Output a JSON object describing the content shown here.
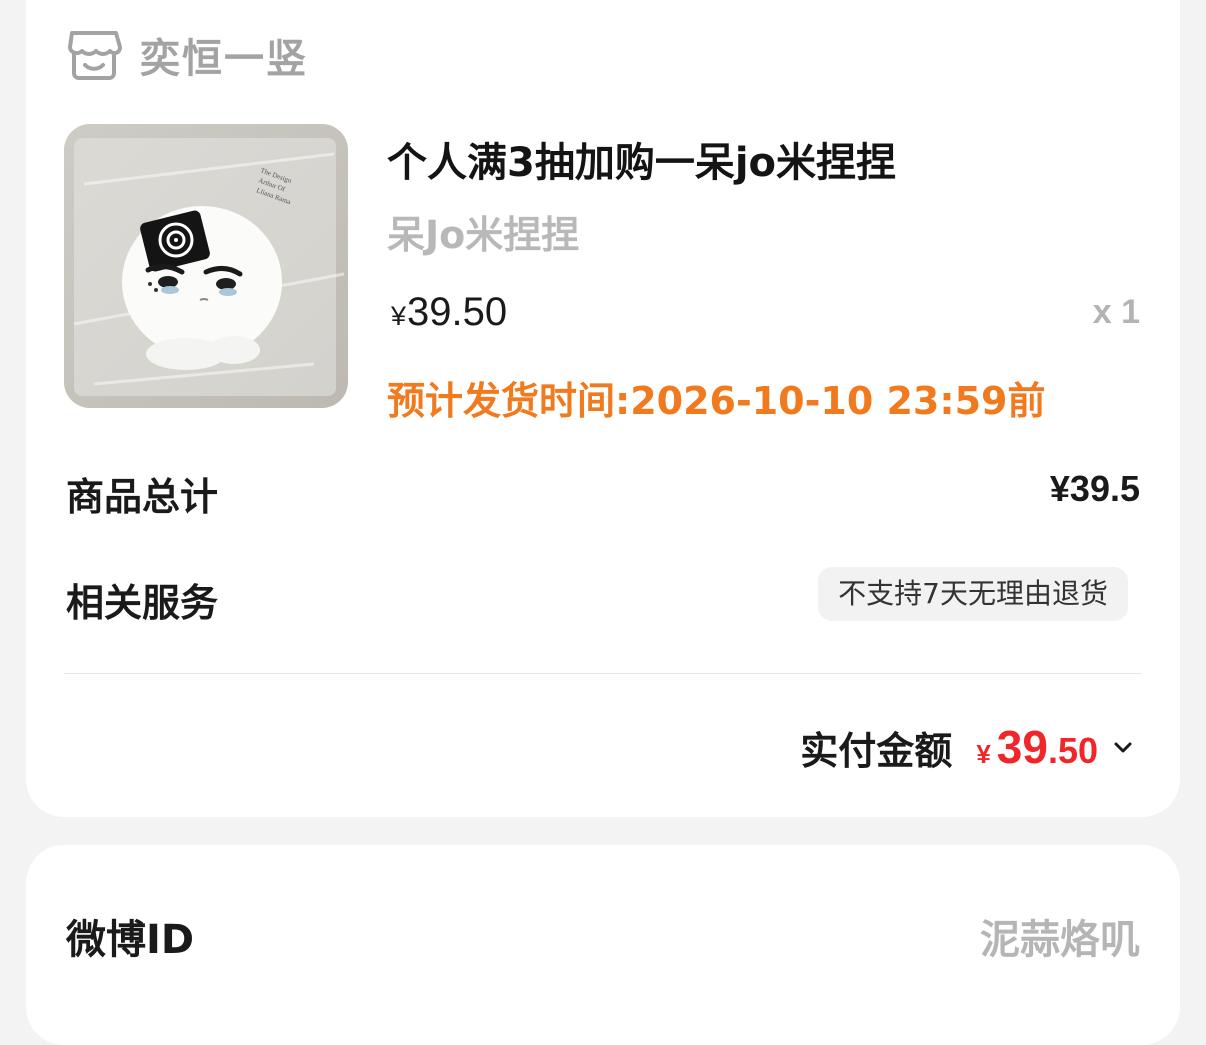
{
  "shop": {
    "icon": "store-icon",
    "name": "奕恒一竖"
  },
  "product": {
    "image_icon": "product-photo",
    "title": "个人满3抽加购一呆jo米捏捏",
    "variant": "呆Jo米捏捏",
    "price_symbol": "¥",
    "price_value": "39.50",
    "quantity": "x 1",
    "ship_time": "预计发货时间:2026-10-10 23:59前"
  },
  "summary": {
    "total_label": "商品总计",
    "total_value": "¥39.5",
    "service_label": "相关服务",
    "service_tag": "不支持7天无理由退货",
    "paid_label": "实付金额",
    "paid_symbol": "¥",
    "paid_int": "39",
    "paid_dec": ".50",
    "expand_icon": "chevron-down-icon"
  },
  "weibo": {
    "label": "微博ID",
    "value": "泥蒜烙叽"
  },
  "colors": {
    "accent_orange": "#f07a1d",
    "price_red": "#f0262a",
    "muted_gray": "#b5b5b5",
    "background": "#f3f3f3"
  }
}
